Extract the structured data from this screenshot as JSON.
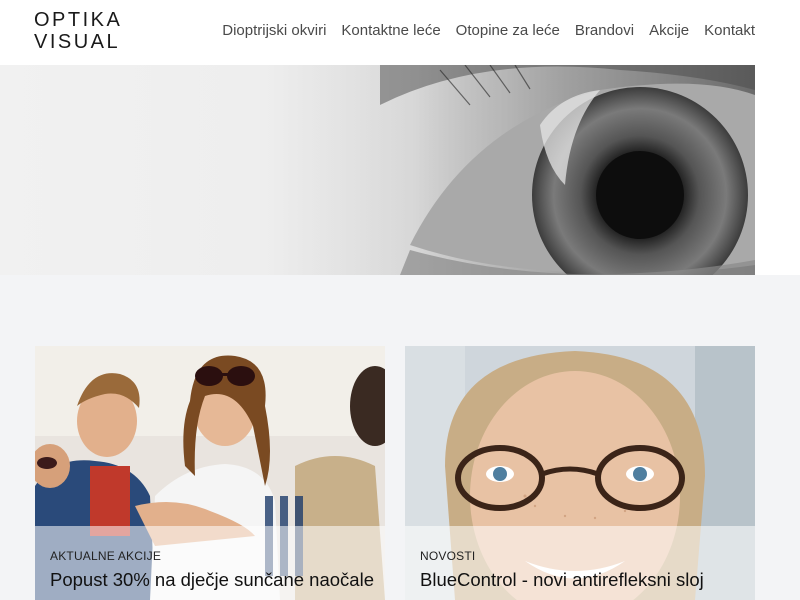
{
  "header": {
    "logo_line1": "OPTIKA",
    "logo_line2": "VISUAL",
    "nav": [
      "Dioptrijski okviri",
      "Kontaktne leće",
      "Otopine za leće",
      "Brandovi",
      "Akcije",
      "Kontakt"
    ]
  },
  "hero": {
    "image": "eye-closeup-grayscale"
  },
  "cards": [
    {
      "category": "AKTUALNE AKCIJE",
      "title": "Popust 30% na dječje sunčane naočale",
      "image": "children-wearing-sunglasses"
    },
    {
      "category": "NOVOSTI",
      "title": "BlueControl - novi antirefleksni sloj",
      "image": "woman-wearing-glasses"
    }
  ],
  "colors": {
    "page_background": "#f3f4f6",
    "header_background": "#ffffff",
    "nav_text": "#4a4a4a"
  }
}
